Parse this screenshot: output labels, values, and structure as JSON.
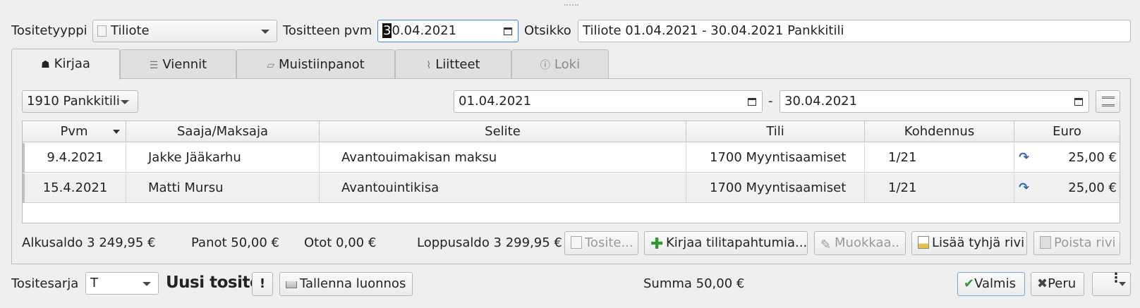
{
  "header": {
    "type_label": "Tositetyyppi",
    "type_value": "Tiliote",
    "date_label": "Tositteen pvm",
    "date_cursor_char": "3",
    "date_value_rest": "0.04.2021",
    "title_label": "Otsikko",
    "title_value": "Tiliote 01.04.2021 - 30.04.2021 Pankkitili"
  },
  "tabs": [
    {
      "label": "Kirjaa",
      "icon": "stamp-icon",
      "active": true
    },
    {
      "label": "Viennit",
      "icon": "list-icon"
    },
    {
      "label": "Muistiinpanot",
      "icon": "note-icon"
    },
    {
      "label": "Liitteet",
      "icon": "paperclip-icon"
    },
    {
      "label": "Loki",
      "icon": "info-icon",
      "disabled": true
    }
  ],
  "filter": {
    "account": "1910 Pankkitili",
    "start_date": "01.04.2021",
    "separator": "-",
    "end_date": "30.04.2021"
  },
  "table": {
    "columns": [
      "Pvm",
      "Saaja/Maksaja",
      "Selite",
      "Tili",
      "Kohdennus",
      "Euro"
    ],
    "rows": [
      {
        "pvm": "9.4.2021",
        "saaja": "Jakke Jääkarhu",
        "selite": "Avantouimakisan maksu",
        "tili": "1700 Myyntisaamiset",
        "kohdennus": "1/21",
        "euro": "25,00 €"
      },
      {
        "pvm": "15.4.2021",
        "saaja": "Matti Mursu",
        "selite": "Avantouintikisa",
        "tili": "1700 Myyntisaamiset",
        "kohdennus": "1/21",
        "euro": "25,00 €"
      }
    ]
  },
  "summary": {
    "alkusaldo": "Alkusaldo 3 249,95 €",
    "panot": "Panot 50,00 €",
    "otot": "Otot 0,00 €",
    "loppusaldo": "Loppusaldo 3 299,95 €"
  },
  "actions": {
    "tosite": "Tosite...",
    "kirjaa": "Kirjaa tilitapahtumia...",
    "muokkaa": "Muokkaa..",
    "lisaa": "Lisää tyhjä rivi",
    "poista": "Poista rivi"
  },
  "footer": {
    "series_label": "Tositesarja",
    "series_value": "T",
    "doc_title": "Uusi tosite",
    "warning": "!",
    "save_draft": "Tallenna luonnos",
    "sum": "Summa 50,00 €",
    "ok": "Valmis",
    "cancel": "Peru"
  }
}
